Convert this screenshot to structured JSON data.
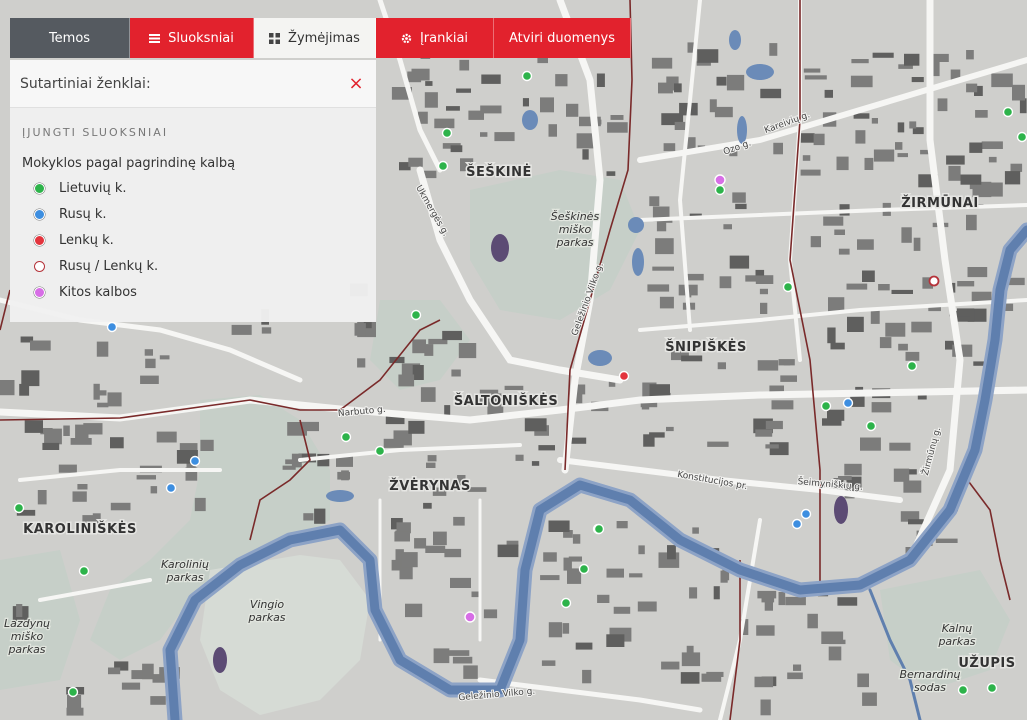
{
  "tabs": [
    {
      "label": "Temos",
      "icon": "none",
      "style": "dark"
    },
    {
      "label": "Sluoksniai",
      "icon": "list-icon",
      "style": "red"
    },
    {
      "label": "Žymėjimas",
      "icon": "grid-icon",
      "style": "active"
    },
    {
      "label": "Įrankiai",
      "icon": "gear-icon",
      "style": "red"
    },
    {
      "label": "Atviri duomenys",
      "icon": "none",
      "style": "red"
    }
  ],
  "legend": {
    "title": "Sutartiniai ženklai:",
    "close_symbol": "×",
    "layers_title": "ĮJUNGTI SLUOKSNIAI",
    "layer_name": "Mokyklos pagal pagrindinę kalbą",
    "items": [
      {
        "label": "Lietuvių k.",
        "color": "#2db34a",
        "border": "#ffffff"
      },
      {
        "label": "Rusų k.",
        "color": "#3d8ee0",
        "border": "#ffffff"
      },
      {
        "label": "Lenkų k.",
        "color": "#e3343d",
        "border": "#ffffff"
      },
      {
        "label": "Rusų / Lenkų k.",
        "color": "#ffffff",
        "border": "#b5333a"
      },
      {
        "label": "Kitos kalbos",
        "color": "#d76ee6",
        "border": "#ffffff"
      }
    ]
  },
  "map": {
    "colors": {
      "river": "#5f7fae",
      "river_edge": "#8da3c6",
      "park": "#c8d0c9",
      "urban": "#cfcfcc",
      "block": "#7c7c7b",
      "road": "#f6f6f4",
      "boundary": "#7a2a2a"
    },
    "districts": [
      {
        "name": "ŠEŠKINĖ"
      },
      {
        "name": "ŽIRMŪNAI"
      },
      {
        "name": "ŠNIPIŠKĖS"
      },
      {
        "name": "ŠALTONIŠKĖS"
      },
      {
        "name": "ŽVĖRYNAS"
      },
      {
        "name": "KAROLINIŠKĖS"
      },
      {
        "name": "UŽUPIS"
      }
    ],
    "parks": [
      {
        "lines": [
          "Šeškinės",
          "miško",
          "parkas"
        ]
      },
      {
        "lines": [
          "Karolinių",
          "parkas"
        ]
      },
      {
        "lines": [
          "Vingio",
          "parkas"
        ]
      },
      {
        "lines": [
          "Lazdynų",
          "miško",
          "parkas"
        ]
      },
      {
        "lines": [
          "Kalnų",
          "parkas"
        ]
      },
      {
        "lines": [
          "Bernardinų",
          "sodas"
        ]
      }
    ],
    "streets": [
      "Ukmergės g.",
      "Geležinio Vilko g.",
      "Narbuto g.",
      "Konstitucijos pr.",
      "Šeimyniškių g.",
      "Žirmūnų g.",
      "Kareivių g.",
      "Ozo g.",
      "Geležinio Vilko g."
    ],
    "markers": [
      {
        "type": "lt"
      },
      {
        "type": "lt"
      },
      {
        "type": "lt"
      },
      {
        "type": "lt"
      },
      {
        "type": "other"
      },
      {
        "type": "lt"
      },
      {
        "type": "lt"
      },
      {
        "type": "lt"
      },
      {
        "type": "ru"
      },
      {
        "type": "ru"
      },
      {
        "type": "ru"
      },
      {
        "type": "lt"
      },
      {
        "type": "lt"
      },
      {
        "type": "pl"
      },
      {
        "type": "lt"
      },
      {
        "type": "rupl"
      },
      {
        "type": "lt"
      },
      {
        "type": "lt"
      },
      {
        "type": "ru"
      },
      {
        "type": "lt"
      },
      {
        "type": "lt"
      },
      {
        "type": "ru"
      },
      {
        "type": "ru"
      },
      {
        "type": "lt"
      },
      {
        "type": "lt"
      },
      {
        "type": "lt"
      },
      {
        "type": "other"
      },
      {
        "type": "lt"
      },
      {
        "type": "lt"
      },
      {
        "type": "lt"
      },
      {
        "type": "lt"
      },
      {
        "type": "lt"
      }
    ]
  }
}
